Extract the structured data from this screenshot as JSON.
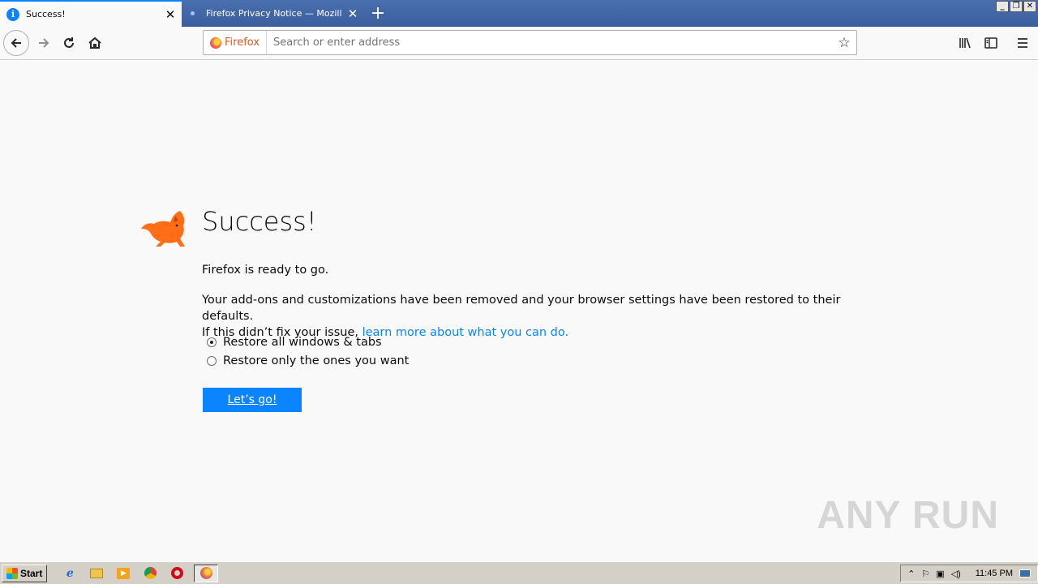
{
  "tabs": [
    {
      "label": "Success!",
      "active": true
    },
    {
      "label": "Firefox Privacy Notice — Mozilla",
      "active": false
    }
  ],
  "window_controls": [
    "_",
    "❐",
    "✕"
  ],
  "urlbar": {
    "identity_label": "Firefox",
    "placeholder": "Search or enter address"
  },
  "page": {
    "title": "Success!",
    "ready_text": "Firefox is ready to go.",
    "desc_line1": "Your add-ons and customizations have been removed and your browser settings have been restored to their defaults.",
    "desc_line2_prefix": "If this didn’t fix your issue, ",
    "learn_more_link": "learn more about what you can do.",
    "radio_options": [
      {
        "label": "Restore all windows & tabs",
        "selected": true
      },
      {
        "label": "Restore only the ones you want",
        "selected": false
      }
    ],
    "go_button": "Let’s go!"
  },
  "watermark": "ANY RUN",
  "taskbar": {
    "start_label": "Start",
    "clock": "11:45 PM"
  },
  "colors": {
    "accent": "#0a84ff",
    "fox": "#ff6d16"
  }
}
